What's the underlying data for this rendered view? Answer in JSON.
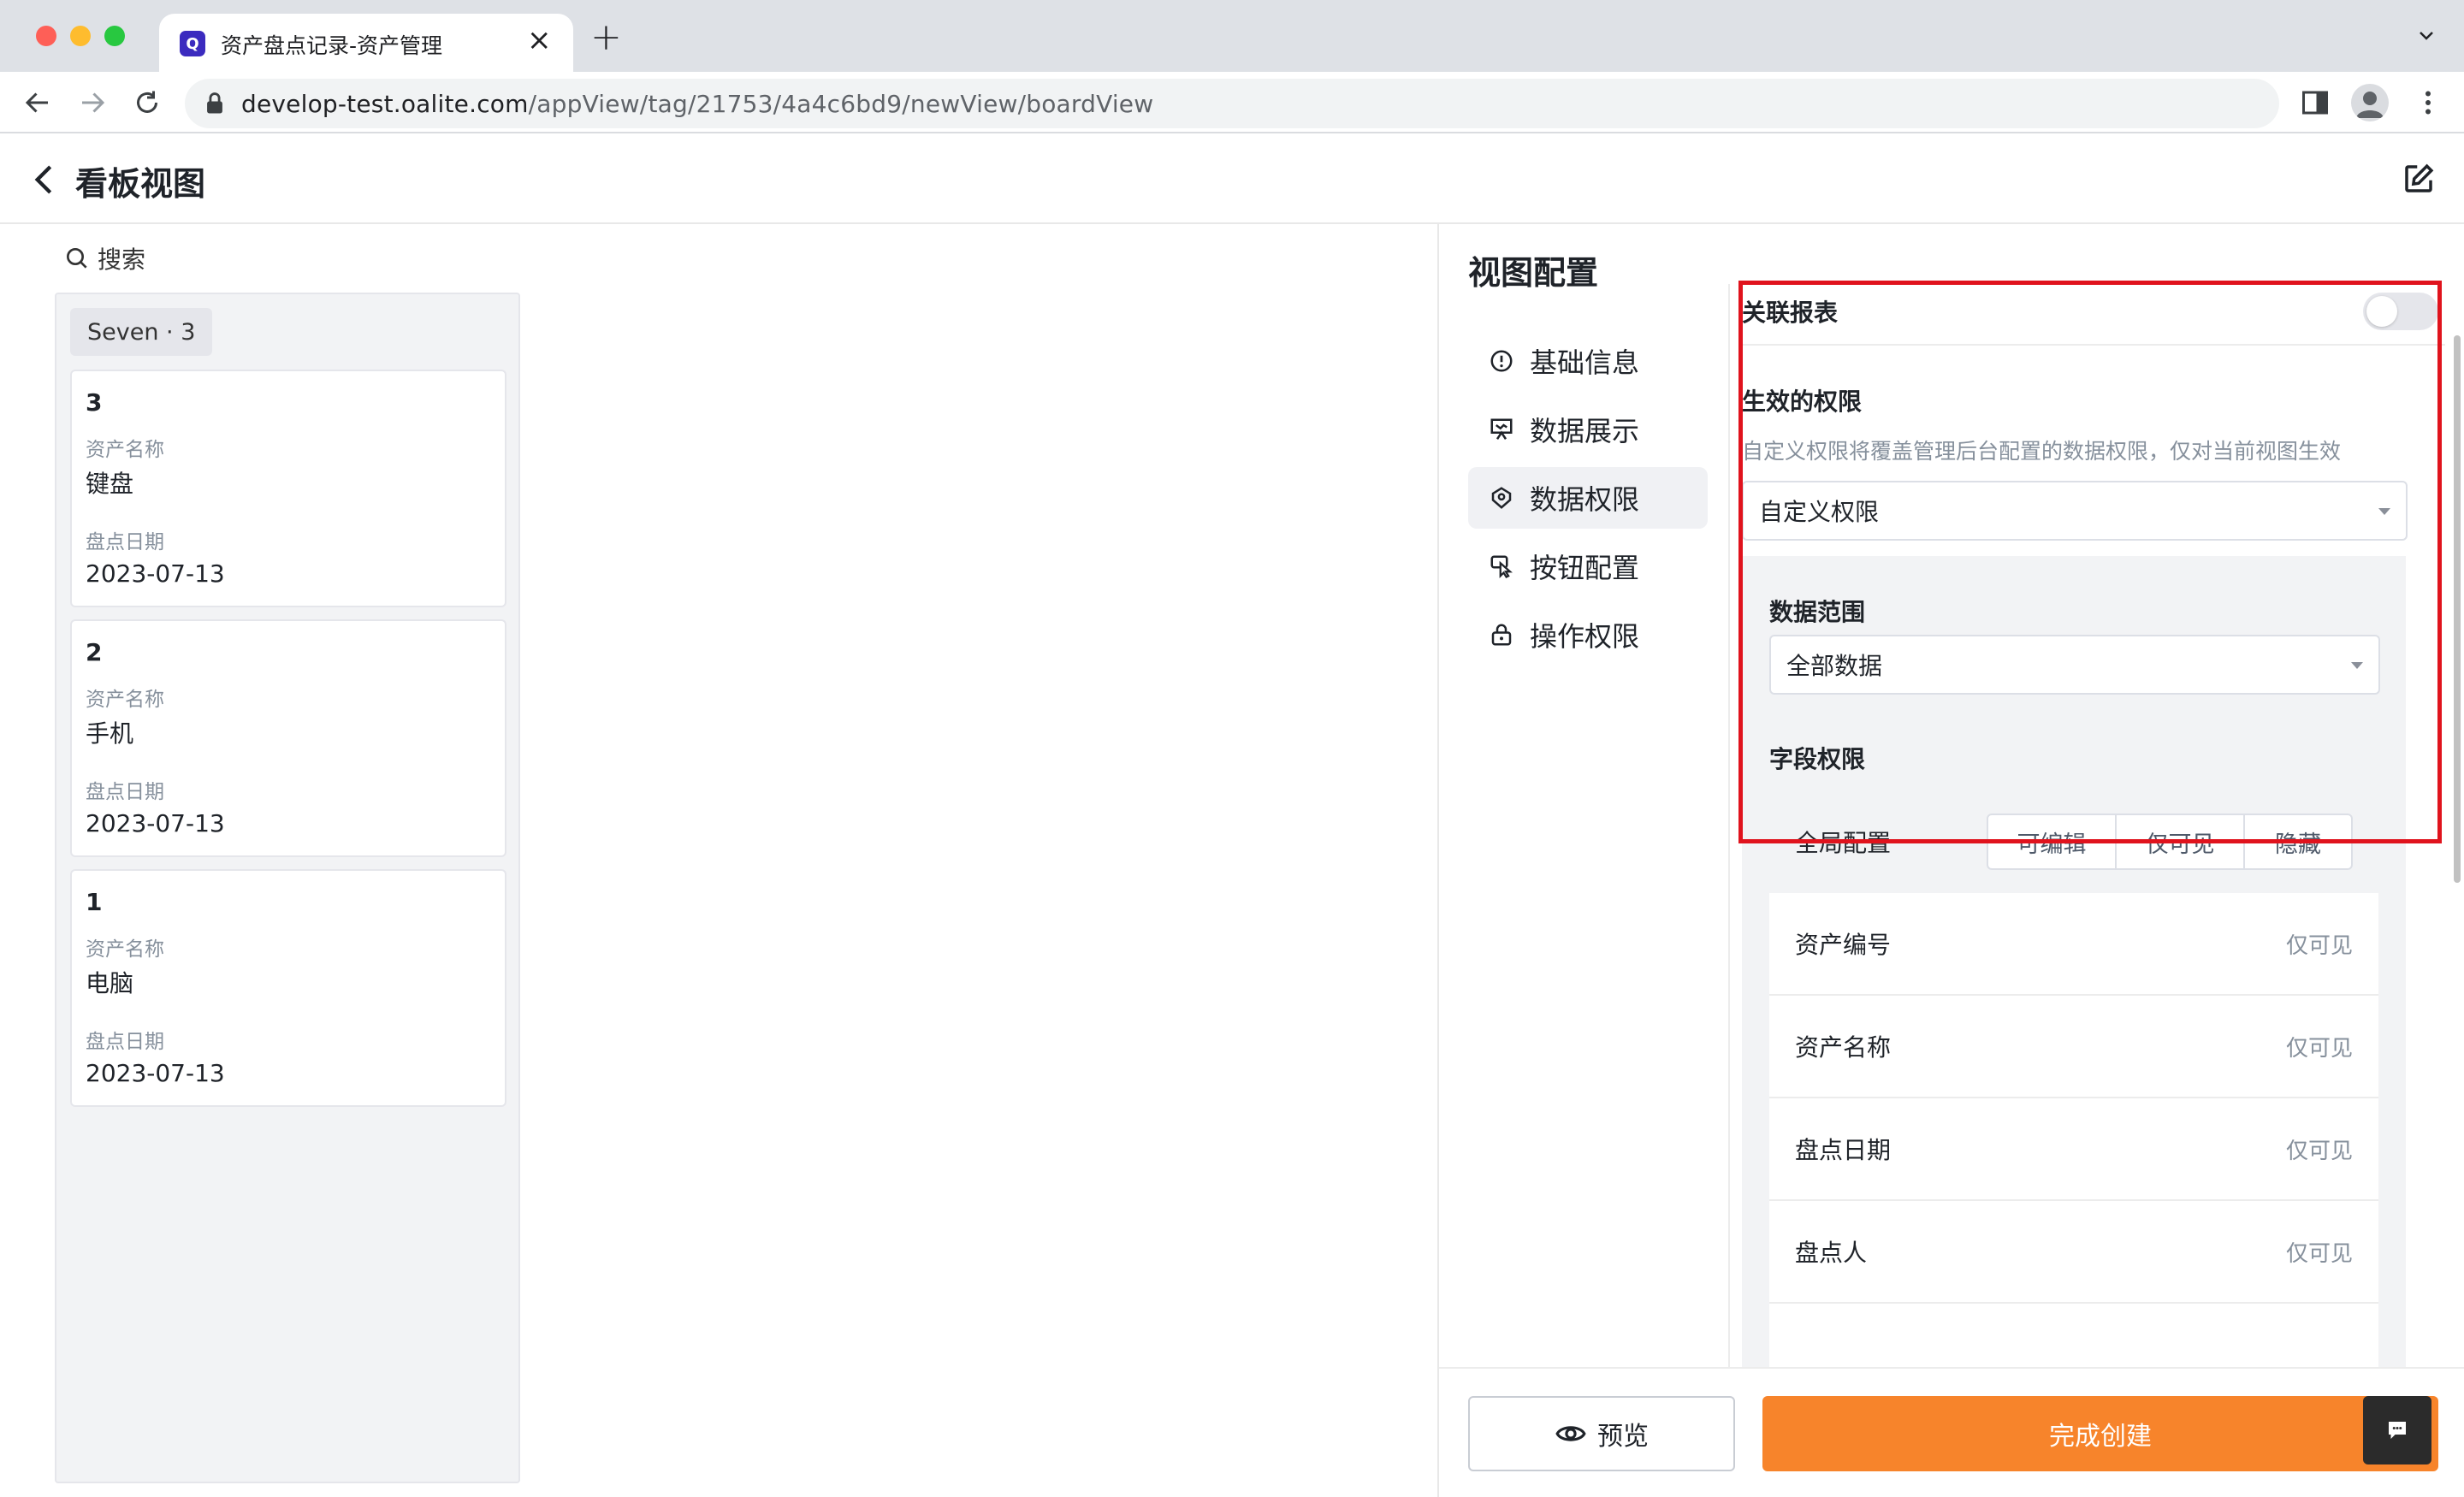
{
  "browser": {
    "tab_title": "资产盘点记录-资产管理",
    "favicon_letter": "Q",
    "url_domain": "develop-test.oalite.com",
    "url_path": "/appView/tag/21753/4a4c6bd9/newView/boardView"
  },
  "header": {
    "title": "看板视图"
  },
  "board": {
    "search_label": "搜索",
    "group_label": "Seven · 3",
    "cards": [
      {
        "num": "3",
        "name_label": "资产名称",
        "name": "键盘",
        "date_label": "盘点日期",
        "date": "2023-07-13"
      },
      {
        "num": "2",
        "name_label": "资产名称",
        "name": "手机",
        "date_label": "盘点日期",
        "date": "2023-07-13"
      },
      {
        "num": "1",
        "name_label": "资产名称",
        "name": "电脑",
        "date_label": "盘点日期",
        "date": "2023-07-13"
      }
    ]
  },
  "config": {
    "title": "视图配置",
    "menu": [
      {
        "label": "基础信息",
        "icon": "info-circle-icon"
      },
      {
        "label": "数据展示",
        "icon": "presentation-icon"
      },
      {
        "label": "数据权限",
        "icon": "shield-icon",
        "active": true
      },
      {
        "label": "按钮配置",
        "icon": "pointer-icon"
      },
      {
        "label": "操作权限",
        "icon": "lock-icon"
      }
    ],
    "linked_report_label": "关联报表",
    "linked_report_enabled": false,
    "effective_perm_label": "生效的权限",
    "effective_perm_hint": "自定义权限将覆盖管理后台配置的数据权限，仅对当前视图生效",
    "effective_perm_value": "自定义权限",
    "data_scope_label": "数据范围",
    "data_scope_value": "全部数据",
    "field_perm_label": "字段权限",
    "global_config_label": "全局配置",
    "segments": [
      "可编辑",
      "仅可见",
      "隐藏"
    ],
    "fields": [
      {
        "name": "资产编号",
        "perm": "仅可见"
      },
      {
        "name": "资产名称",
        "perm": "仅可见"
      },
      {
        "name": "盘点日期",
        "perm": "仅可见"
      },
      {
        "name": "盘点人",
        "perm": "仅可见"
      }
    ],
    "preview_label": "预览",
    "finish_label": "完成创建"
  },
  "colors": {
    "accent": "#f7842b",
    "highlight": "#e0131d"
  }
}
